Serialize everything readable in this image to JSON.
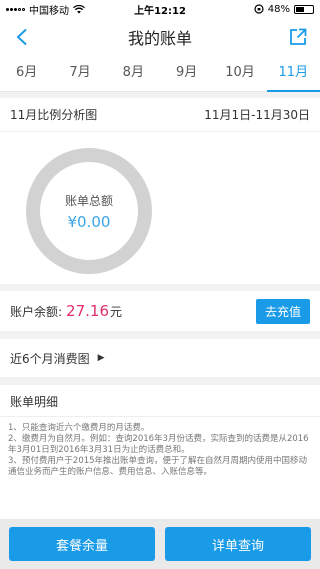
{
  "status_bar": {
    "carrier": "中国移动",
    "time": "上午12:12",
    "battery": "48%",
    "battery_level": 0.48
  },
  "nav": {
    "title": "我的账单",
    "back_icon": "chevron-left-icon",
    "share_icon": "share-out-icon"
  },
  "months": [
    "6月",
    "7月",
    "8月",
    "9月",
    "10月",
    "11月"
  ],
  "active_month_index": 5,
  "analysis": {
    "title": "11月比例分析图",
    "date_range": "11月1日-11月30日",
    "total_label": "账单总额",
    "total_value": "¥0.00"
  },
  "balance": {
    "label": "账户余额:",
    "amount": "27.16",
    "unit": "元",
    "recharge_label": "去充值"
  },
  "six_month": {
    "label": "近6个月消费图"
  },
  "detail": {
    "title": "账单明细",
    "notes": [
      "1、只能查询近六个缴费月的月话费。",
      "2、缴费月为自然月。例如：查询2016年3月份话费，实际查到的话费是从2016年3月01日到2016年3月31日为止的话费总和。",
      "3、预付费用户于2015年推出账单查询，便于了解在自然月周期内使用中国移动通信业务而产生的账户信息、费用信息、入账信息等。"
    ]
  },
  "bottom": {
    "left_label": "套餐余量",
    "right_label": "详单查询"
  },
  "colors": {
    "accent": "#1a9be8",
    "balance_amount": "#e0306b",
    "donut_ring": "#d2d2d2"
  }
}
